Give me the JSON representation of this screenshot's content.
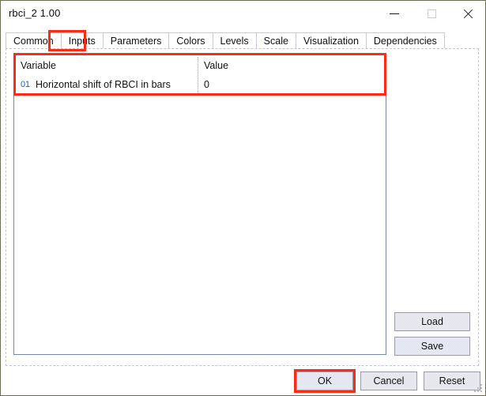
{
  "window": {
    "title": "rbci_2 1.00",
    "controls": {
      "minimize": "minimize-icon",
      "maximize": "maximize-icon",
      "close": "close-icon"
    }
  },
  "tabs": [
    {
      "label": "Common",
      "active": false
    },
    {
      "label": "Inputs",
      "active": true
    },
    {
      "label": "Parameters",
      "active": false
    },
    {
      "label": "Colors",
      "active": false
    },
    {
      "label": "Levels",
      "active": false
    },
    {
      "label": "Scale",
      "active": false
    },
    {
      "label": "Visualization",
      "active": false
    },
    {
      "label": "Dependencies",
      "active": false
    }
  ],
  "inputs_table": {
    "columns": [
      "Variable",
      "Value"
    ],
    "rows": [
      {
        "icon": "01",
        "variable": "Horizontal shift of RBCI in bars",
        "value": "0"
      }
    ]
  },
  "side_buttons": {
    "load": "Load",
    "save": "Save"
  },
  "dialog_buttons": {
    "ok": "OK",
    "cancel": "Cancel",
    "reset": "Reset"
  },
  "highlights": {
    "color": "#fb2b1a",
    "targets": [
      "Inputs tab",
      "Inputs table header and first row",
      "OK button"
    ]
  }
}
